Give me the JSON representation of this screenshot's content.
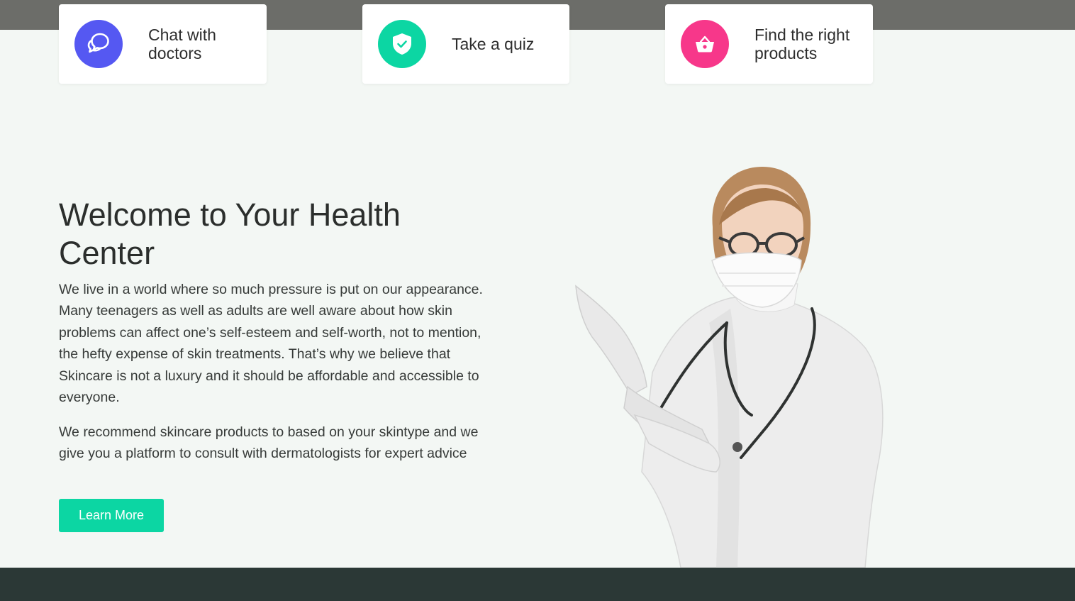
{
  "features": [
    {
      "label": "Chat with\ndoctors",
      "icon": "chat-bubbles-icon",
      "color": "#5558f2"
    },
    {
      "label": "Take a quiz",
      "icon": "shield-check-icon",
      "color": "#0cd6a3"
    },
    {
      "label": "Find the right\nproducts",
      "icon": "shopping-basket-icon",
      "color": "#f7378a"
    }
  ],
  "hero": {
    "title": "Welcome to Your Health Center",
    "paragraph_1": "We live in a world where so much pressure is put on our appearance. Many teenagers as well as adults are well aware about how skin problems can affect one’s self-esteem and self-worth, not to mention, the hefty expense of skin treatments. That’s why we believe that Skincare is not a luxury and it should be affordable and accessible to everyone.",
    "paragraph_2": "We recommend skincare products to based on your skintype and we give you a platform to consult with dermatologists for expert advice",
    "button_label": "Learn More"
  },
  "colors": {
    "accent": "#0cd6a3",
    "chat": "#5558f2",
    "products": "#f7378a",
    "top_band": "#6c6d69",
    "footer": "#2b3836",
    "background": "#f3f7f4"
  },
  "illustration": "doctor-portrait"
}
